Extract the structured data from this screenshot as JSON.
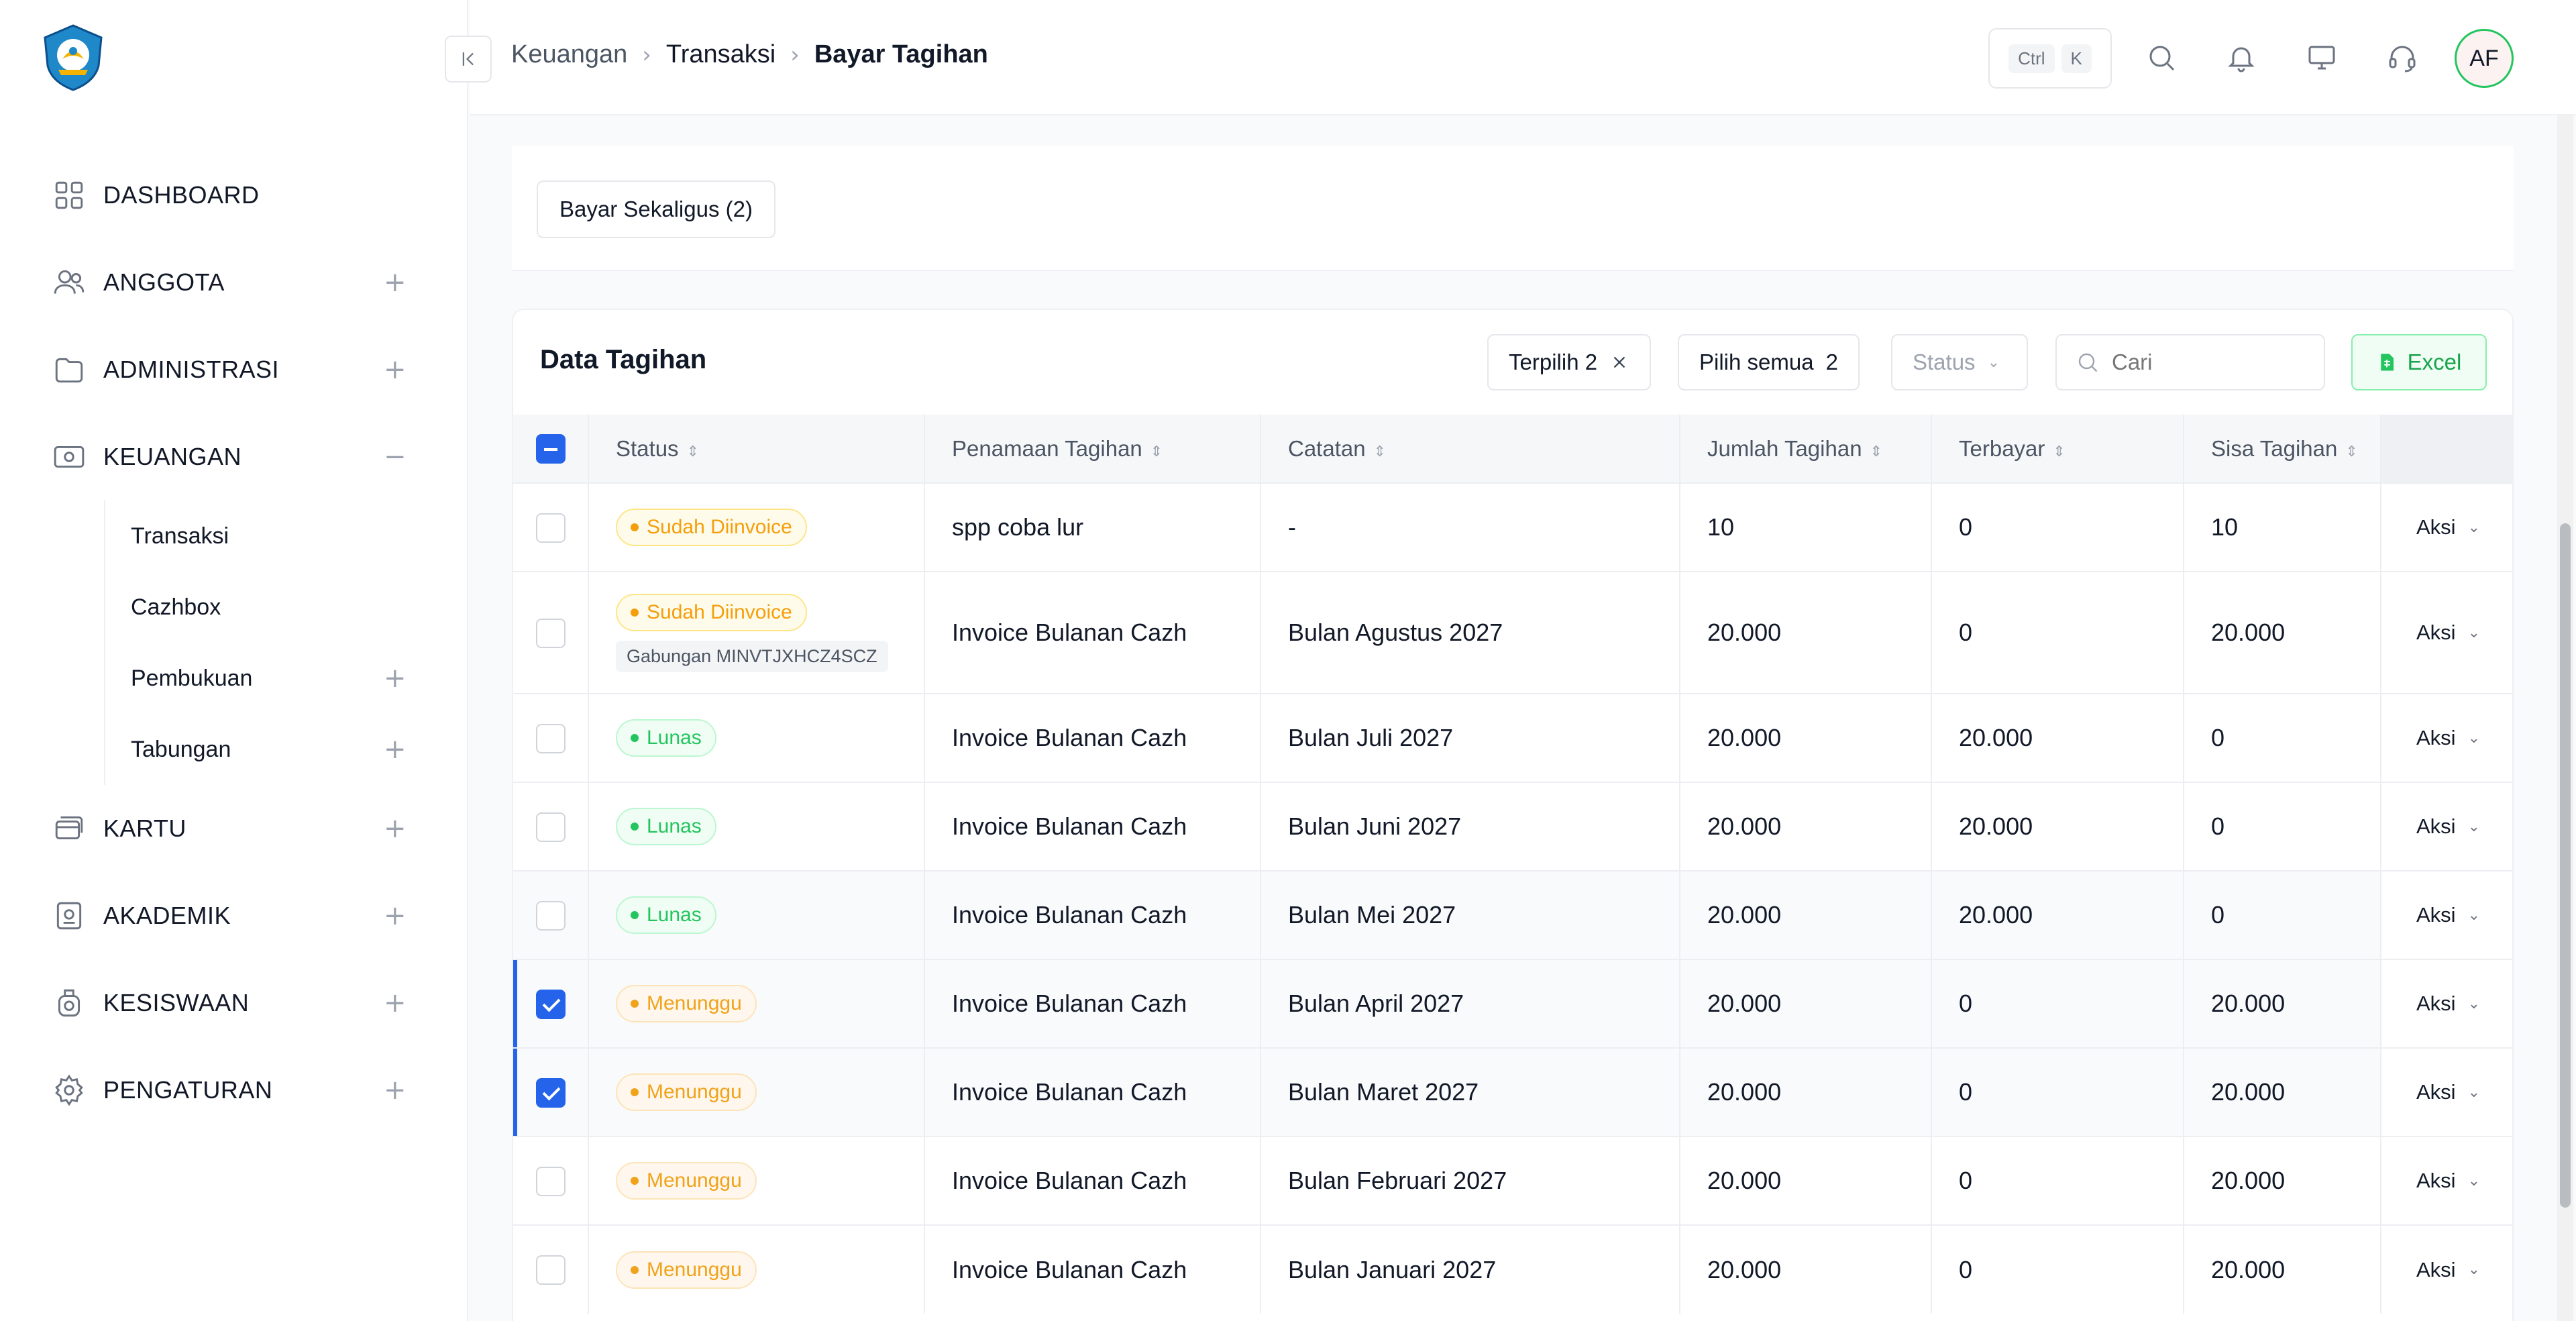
{
  "sidebar": {
    "items": [
      {
        "label": "DASHBOARD",
        "icon": "grid-icon",
        "toggle": ""
      },
      {
        "label": "ANGGOTA",
        "icon": "users-icon",
        "toggle": "+"
      },
      {
        "label": "ADMINISTRASI",
        "icon": "folder-icon",
        "toggle": "+"
      },
      {
        "label": "KEUANGAN",
        "icon": "money-icon",
        "toggle": "−"
      }
    ],
    "keuangan_sub": [
      {
        "label": "Transaksi",
        "toggle": ""
      },
      {
        "label": "Cazhbox",
        "toggle": ""
      },
      {
        "label": "Pembukuan",
        "toggle": "+"
      },
      {
        "label": "Tabungan",
        "toggle": "+"
      }
    ],
    "items_after": [
      {
        "label": "KARTU",
        "icon": "card-icon",
        "toggle": "+"
      },
      {
        "label": "AKADEMIK",
        "icon": "academic-icon",
        "toggle": "+"
      },
      {
        "label": "KESISWAAN",
        "icon": "student-icon",
        "toggle": "+"
      },
      {
        "label": "PENGATURAN",
        "icon": "gear-icon",
        "toggle": "+"
      }
    ]
  },
  "topbar": {
    "breadcrumb": [
      "Keuangan",
      "Transaksi",
      "Bayar Tagihan"
    ],
    "breadcrumb_sep": ">",
    "kbd": [
      "Ctrl",
      "K"
    ],
    "avatar": "AF"
  },
  "main": {
    "pay_all_label": "Bayar Sekaligus (2)",
    "card_title": "Data Tagihan",
    "selected_label": "Terpilih 2",
    "select_all_label": "Pilih semua",
    "select_all_count": "2",
    "status_label": "Status",
    "search_placeholder": "Cari",
    "excel_label": "Excel"
  },
  "table": {
    "headers": [
      "Status",
      "Penamaan Tagihan",
      "Catatan",
      "Jumlah Tagihan",
      "Terbayar",
      "Sisa Tagihan"
    ],
    "action_label": "Aksi",
    "rows": [
      {
        "status": "Sudah Diinvoice",
        "status_color": "yellow",
        "extra": "",
        "name": "spp coba lur",
        "note": "-",
        "amount": "10",
        "paid": "0",
        "remaining": "10",
        "checked": false
      },
      {
        "status": "Sudah Diinvoice",
        "status_color": "yellow",
        "extra": "Gabungan MINVTJXHCZ4SCZ",
        "name": "Invoice Bulanan Cazh",
        "note": "Bulan Agustus 2027",
        "amount": "20.000",
        "paid": "0",
        "remaining": "20.000",
        "checked": false
      },
      {
        "status": "Lunas",
        "status_color": "green",
        "extra": "",
        "name": "Invoice Bulanan Cazh",
        "note": "Bulan Juli 2027",
        "amount": "20.000",
        "paid": "20.000",
        "remaining": "0",
        "checked": false
      },
      {
        "status": "Lunas",
        "status_color": "green",
        "extra": "",
        "name": "Invoice Bulanan Cazh",
        "note": "Bulan Juni 2027",
        "amount": "20.000",
        "paid": "20.000",
        "remaining": "0",
        "checked": false
      },
      {
        "status": "Lunas",
        "status_color": "green",
        "extra": "",
        "name": "Invoice Bulanan Cazh",
        "note": "Bulan Mei 2027",
        "amount": "20.000",
        "paid": "20.000",
        "remaining": "0",
        "checked": false
      },
      {
        "status": "Menunggu",
        "status_color": "orange",
        "extra": "",
        "name": "Invoice Bulanan Cazh",
        "note": "Bulan April 2027",
        "amount": "20.000",
        "paid": "0",
        "remaining": "20.000",
        "checked": true
      },
      {
        "status": "Menunggu",
        "status_color": "orange",
        "extra": "",
        "name": "Invoice Bulanan Cazh",
        "note": "Bulan Maret 2027",
        "amount": "20.000",
        "paid": "0",
        "remaining": "20.000",
        "checked": true
      },
      {
        "status": "Menunggu",
        "status_color": "orange",
        "extra": "",
        "name": "Invoice Bulanan Cazh",
        "note": "Bulan Februari 2027",
        "amount": "20.000",
        "paid": "0",
        "remaining": "20.000",
        "checked": false
      },
      {
        "status": "Menunggu",
        "status_color": "orange",
        "extra": "",
        "name": "Invoice Bulanan Cazh",
        "note": "Bulan Januari 2027",
        "amount": "20.000",
        "paid": "0",
        "remaining": "20.000",
        "checked": false
      }
    ]
  },
  "colors": {
    "accent": "#2563eb",
    "success": "#22c55e",
    "warning": "#f59e0b"
  }
}
